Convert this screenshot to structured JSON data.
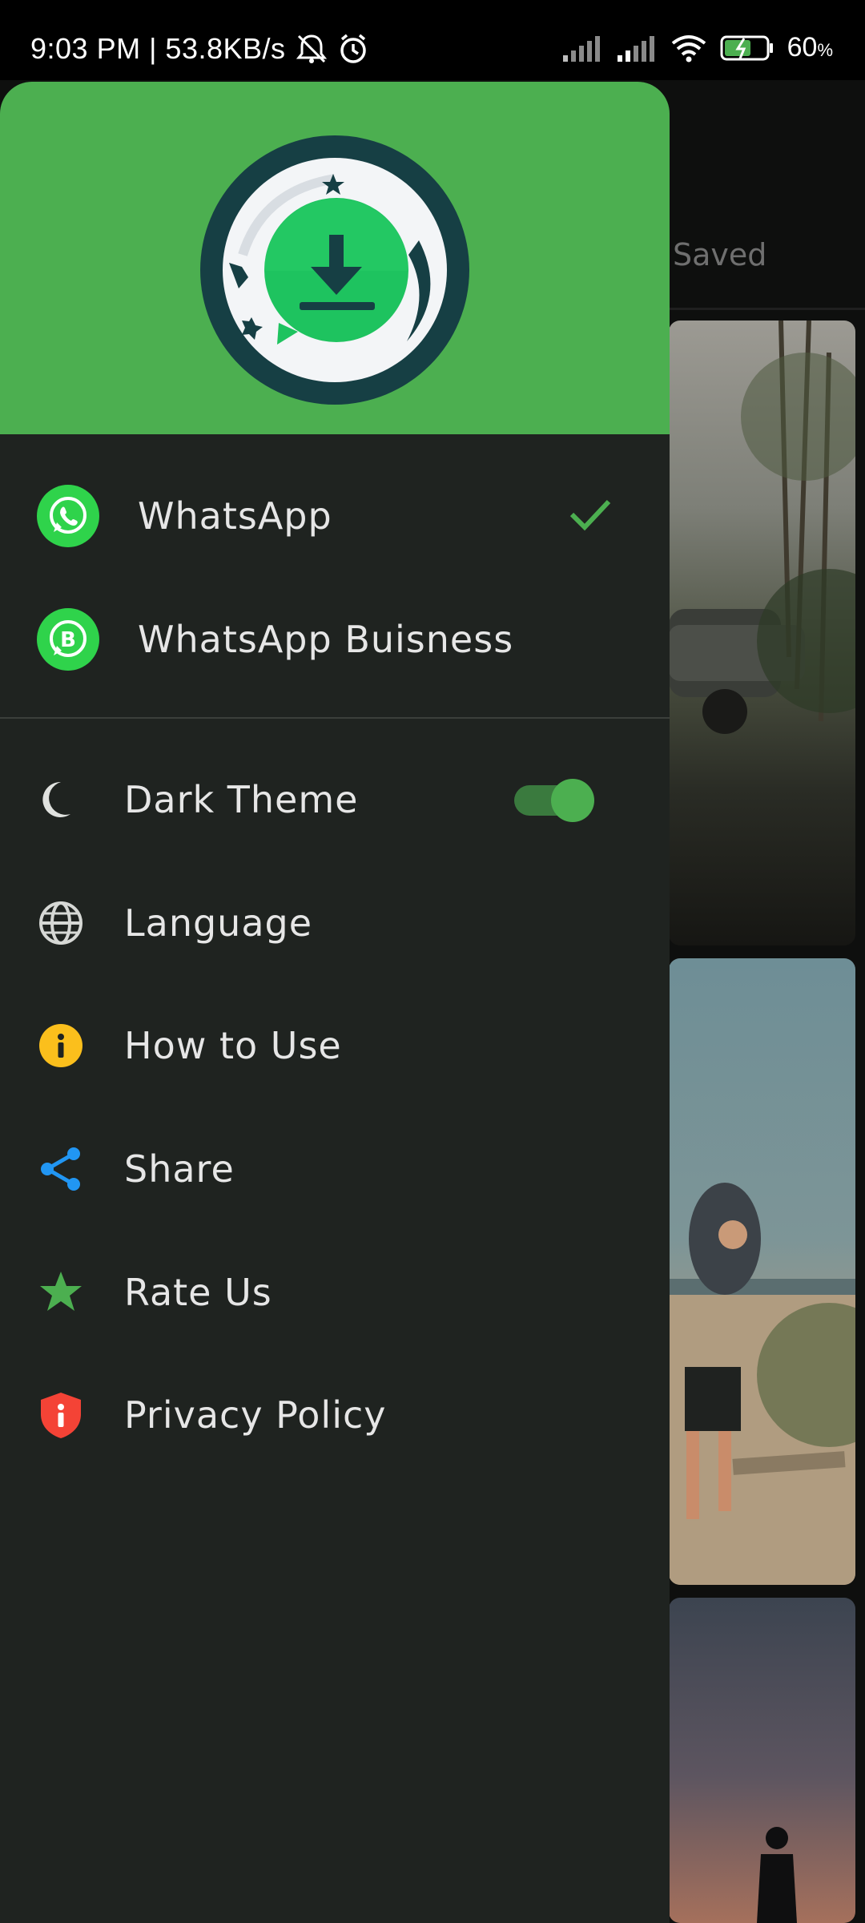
{
  "status_bar": {
    "time_speed": "9:03 PM | 53.8KB/s",
    "battery": "60",
    "battery_unit": "%"
  },
  "background": {
    "tab_label": "Saved"
  },
  "drawer": {
    "apps": [
      {
        "label": "WhatsApp",
        "selected": true,
        "icon": "whatsapp-icon"
      },
      {
        "label": "WhatsApp Buisness",
        "selected": false,
        "icon": "whatsapp-business-icon"
      }
    ],
    "menu": [
      {
        "label": "Dark Theme",
        "icon": "moon-icon",
        "toggle_on": true
      },
      {
        "label": "Language",
        "icon": "globe-icon"
      },
      {
        "label": "How to Use",
        "icon": "info-icon"
      },
      {
        "label": "Share",
        "icon": "share-icon"
      },
      {
        "label": "Rate Us",
        "icon": "star-icon"
      },
      {
        "label": "Privacy Policy",
        "icon": "shield-icon"
      }
    ]
  },
  "colors": {
    "header_green": "#4caf50",
    "drawer_bg": "#1f2320",
    "accent_green": "#4caf50"
  }
}
